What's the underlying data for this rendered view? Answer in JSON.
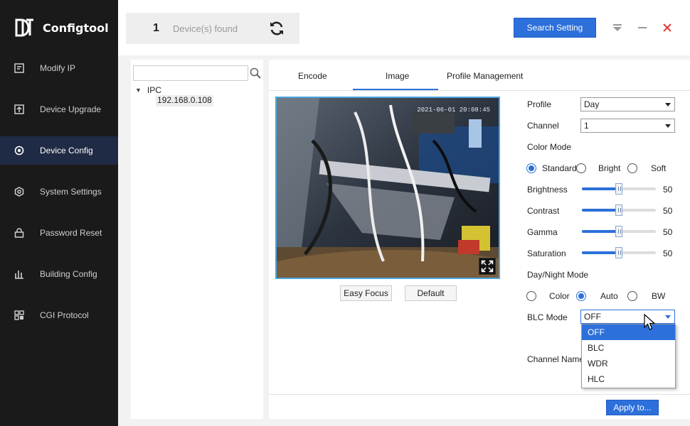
{
  "app": {
    "title": "Configtool",
    "logo_icon": "configtool-logo"
  },
  "sidebar": {
    "items": [
      {
        "label": "Modify IP",
        "icon": "modify-ip-icon"
      },
      {
        "label": "Device Upgrade",
        "icon": "upgrade-icon"
      },
      {
        "label": "Device Config",
        "icon": "device-config-icon",
        "active": true
      },
      {
        "label": "System Settings",
        "icon": "settings-icon"
      },
      {
        "label": "Password Reset",
        "icon": "lock-icon"
      },
      {
        "label": "Building Config",
        "icon": "building-icon"
      },
      {
        "label": "CGI Protocol",
        "icon": "protocol-icon"
      }
    ]
  },
  "header": {
    "device_count": "1",
    "devices_found_label": "Device(s) found",
    "search_setting_label": "Search Setting"
  },
  "tree": {
    "search_placeholder": "",
    "root_label": "IPC",
    "child_label": "192.168.0.108"
  },
  "tabs": [
    {
      "label": "Encode"
    },
    {
      "label": "Image",
      "active": true
    },
    {
      "label": "Profile Management"
    }
  ],
  "preview": {
    "timestamp": "2021-06-01 20:08:45",
    "easy_focus_label": "Easy Focus",
    "default_label": "Default"
  },
  "form": {
    "profile_label": "Profile",
    "profile_value": "Day",
    "channel_label": "Channel",
    "channel_value": "1",
    "color_mode_label": "Color Mode",
    "color_mode_options": [
      "Standard",
      "Bright",
      "Soft"
    ],
    "color_mode_selected": "Standard",
    "sliders": [
      {
        "label": "Brightness",
        "value": "50",
        "level": 0.5
      },
      {
        "label": "Contrast",
        "value": "50",
        "level": 0.5
      },
      {
        "label": "Gamma",
        "value": "50",
        "level": 0.5
      },
      {
        "label": "Saturation",
        "value": "50",
        "level": 0.5
      }
    ],
    "daynight_label": "Day/Night Mode",
    "daynight_options": [
      "Color",
      "Auto",
      "BW"
    ],
    "daynight_selected": "Auto",
    "blc_label": "BLC Mode",
    "blc_value": "OFF",
    "blc_options": [
      "OFF",
      "BLC",
      "WDR",
      "HLC"
    ],
    "channel_name_label": "Channel Name"
  },
  "apply_label": "Apply to...",
  "colors": {
    "accent": "#2d6fdb",
    "sidebar_bg": "#1a1a1a",
    "close": "#e03a3a"
  }
}
